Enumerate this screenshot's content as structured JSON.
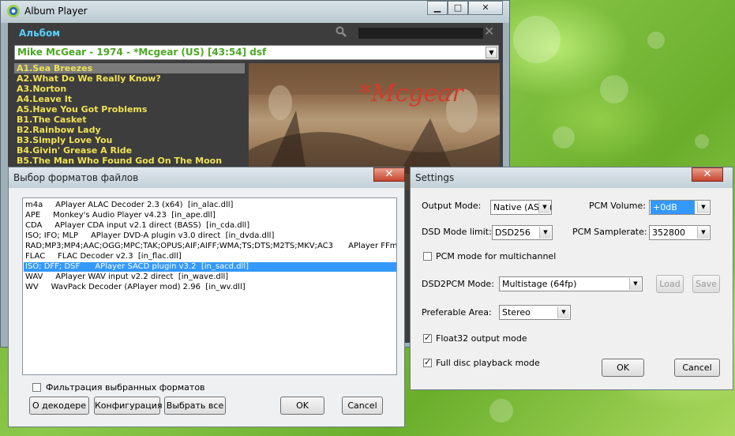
{
  "player": {
    "title": "Album Player",
    "min_label": "▁",
    "max_label": "□",
    "close_label": "✕",
    "album_label": "Альбом",
    "search_placeholder": "",
    "album_select": "Mike McGear - 1974 - *Mcgear (US)  [43:54]  dsf",
    "tracks": [
      "A1.Sea Breezes",
      "A2.What Do We Really Know?",
      "A3.Norton",
      "A4.Leave It",
      "A5.Have You Got Problems",
      "B1.The Casket",
      "B2.Rainbow Lady",
      "B3.Simply Love You",
      "B4.Givin' Grease A Ride",
      "B5.The Man Who Found God On The Moon"
    ],
    "cover_text": "*Mcgear"
  },
  "formats_dialog": {
    "title": "Выбор форматов файлов",
    "close_label": "✕",
    "rows": [
      "m4a     APlayer ALAC Decoder 2.3 (x64)  [in_alac.dll]",
      "APE     Monkey's Audio Player v4.23  [in_ape.dll]",
      "CDA     APlayer CDA input v2.1 direct (BASS)  [in_cda.dll]",
      "ISO; IFO; MLP     APlayer DVD-A plugin v3.0 direct  [in_dvda.dll]",
      "RAD;MP3;MP4;AAC;OGG;MPC;TAK;OPUS;AIF;AIFF;WMA;TS;DTS;M2TS;MKV;AC3      APlayer FFm",
      "FLAC     FLAC Decoder v2.3  [in_flac.dll]",
      "ISO; DFF; DSF      APlayer SACD plugin v3.2  [in_sacd.dll]",
      "WAV     APlayer WAV input v2.2 direct  [in_wave.dll]",
      "WV     WavPack Decoder (APlayer mod) 2.96  [in_wv.dll]"
    ],
    "selected_row": 6,
    "filter_label": "Фильтрация выбранных форматов",
    "filter_checked": false,
    "btn_about": "О декодере",
    "btn_config": "Конфигурация",
    "btn_select_all": "Выбрать все",
    "btn_ok": "OK",
    "btn_cancel": "Cancel"
  },
  "settings_dialog": {
    "title": "Settings",
    "close_label": "✕",
    "output_mode_label": "Output  Mode:",
    "output_mode_value": "Native (ASIO)",
    "pcm_volume_label": "PCM Volume:",
    "pcm_volume_value": "+0dB",
    "dsd_limit_label": "DSD Mode limit:",
    "dsd_limit_value": "DSD256",
    "pcm_samplerate_label": "PCM Samplerate:",
    "pcm_samplerate_value": "352800",
    "pcm_multichannel_label": "PCM mode for multichannel",
    "pcm_multichannel_checked": false,
    "dsd2pcm_label": "DSD2PCM Mode:",
    "dsd2pcm_value": "Multistage (64fp)",
    "btn_load": "Load",
    "btn_save": "Save",
    "area_label": "Preferable Area:",
    "area_value": "Stereo",
    "float32_label": "Float32 output mode",
    "float32_checked": true,
    "full_disc_label": "Full disc playback mode",
    "full_disc_checked": true,
    "btn_ok": "OK",
    "btn_cancel": "Cancel"
  },
  "colors": {
    "track_text": "#efe255",
    "album_label": "#59d0ff",
    "album_text": "#4aa823",
    "selection": "#3399ff",
    "close_red": "#c7452e"
  }
}
